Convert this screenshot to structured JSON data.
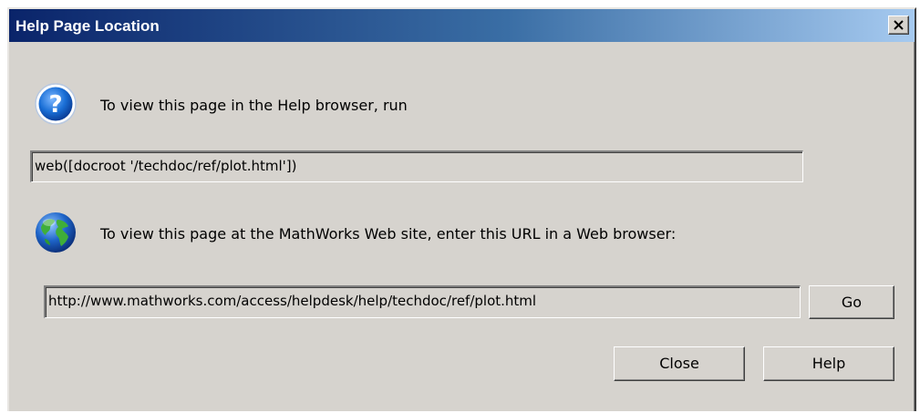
{
  "window": {
    "title": "Help Page Location",
    "close_button_label": "X"
  },
  "help_browser": {
    "icon": "question-icon",
    "message": "To view this page in the Help browser, run",
    "command": "web([docroot '/techdoc/ref/plot.html'])"
  },
  "web_site": {
    "icon": "globe-icon",
    "message": "To view this page at the MathWorks Web site, enter this URL in a Web browser:",
    "url": "http://www.mathworks.com/access/helpdesk/help/techdoc/ref/plot.html",
    "go_label": "Go"
  },
  "buttons": {
    "close_label": "Close",
    "help_label": "Help"
  },
  "colors": {
    "dialog_background": "#d6d3ce",
    "titlebar_start": "#0a246a",
    "titlebar_end": "#a6caf0",
    "title_text": "#ffffff"
  }
}
